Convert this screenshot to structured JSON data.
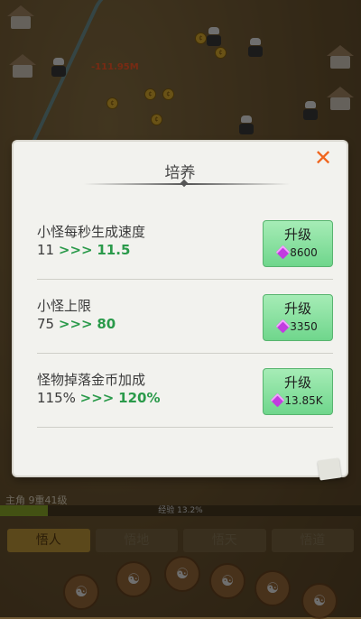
{
  "hud": {
    "damage_text": "-111.95M",
    "player_level": "主角 9重41级",
    "exp_text": "经验 13.2%",
    "exp_progress": 0.132
  },
  "tabs": [
    {
      "label": "悟人",
      "active": true
    },
    {
      "label": "悟地",
      "active": false
    },
    {
      "label": "悟天",
      "active": false
    },
    {
      "label": "悟道",
      "active": false
    }
  ],
  "modal": {
    "title": "培养",
    "close_icon": "close-icon",
    "rows": [
      {
        "name": "小怪每秒生成速度",
        "current": "11",
        "arrow": ">>>",
        "next": "11.5",
        "button_label": "升级",
        "cost": "8600"
      },
      {
        "name": "小怪上限",
        "current": "75",
        "arrow": ">>>",
        "next": "80",
        "button_label": "升级",
        "cost": "3350"
      },
      {
        "name": "怪物掉落金币加成",
        "current": "115%",
        "arrow": ">>>",
        "next": "120%",
        "button_label": "升级",
        "cost": "13.85K"
      }
    ]
  },
  "colors": {
    "accent_green": "#2a9a4a",
    "button_green": "#6fd68c",
    "close_orange": "#f0651d",
    "gem_purple": "#c23ce0"
  }
}
